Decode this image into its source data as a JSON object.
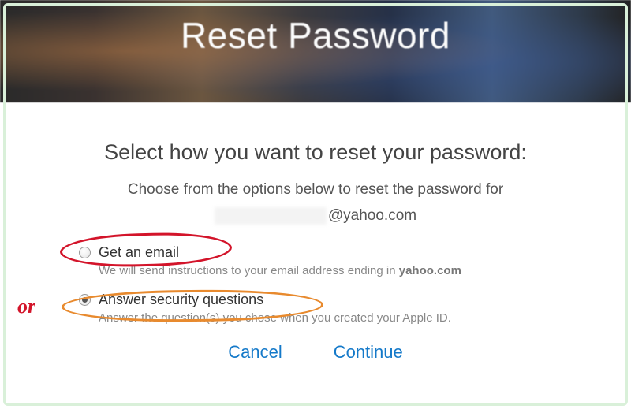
{
  "header": {
    "title": "Reset Password"
  },
  "subtitle": "Select how you want to reset your password:",
  "description": "Choose from the options below to reset the password for",
  "email_domain": "@yahoo.com",
  "options": [
    {
      "label": "Get an email",
      "help_prefix": "We will send instructions to your email address ending in ",
      "help_bold": "yahoo.com",
      "selected": false
    },
    {
      "label": "Answer security questions",
      "help": "Answer the question(s) you chose when you created your Apple ID.",
      "selected": true
    }
  ],
  "actions": {
    "cancel": "Cancel",
    "continue": "Continue"
  },
  "annotations": {
    "or_text": "or"
  }
}
